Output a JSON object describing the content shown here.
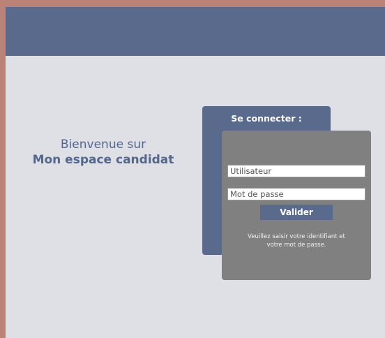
{
  "welcome": {
    "line1": "Bienvenue sur",
    "line2": "Mon espace candidat"
  },
  "login": {
    "title": "Se connecter :",
    "username_placeholder": "Utilisateur",
    "username_value": "",
    "password_placeholder": "Mot de passe",
    "password_value": "",
    "submit_label": "Valider",
    "help_line1": "Veuillez saisir votre identifiant et",
    "help_line2": "votre mot de passe."
  },
  "colors": {
    "outer_background": "#bb8377",
    "page_background": "#dee0e5",
    "header": "#5a6a8c",
    "card_back": "#5a6a8c",
    "card_front": "#808080",
    "accent_text": "#54688e"
  }
}
